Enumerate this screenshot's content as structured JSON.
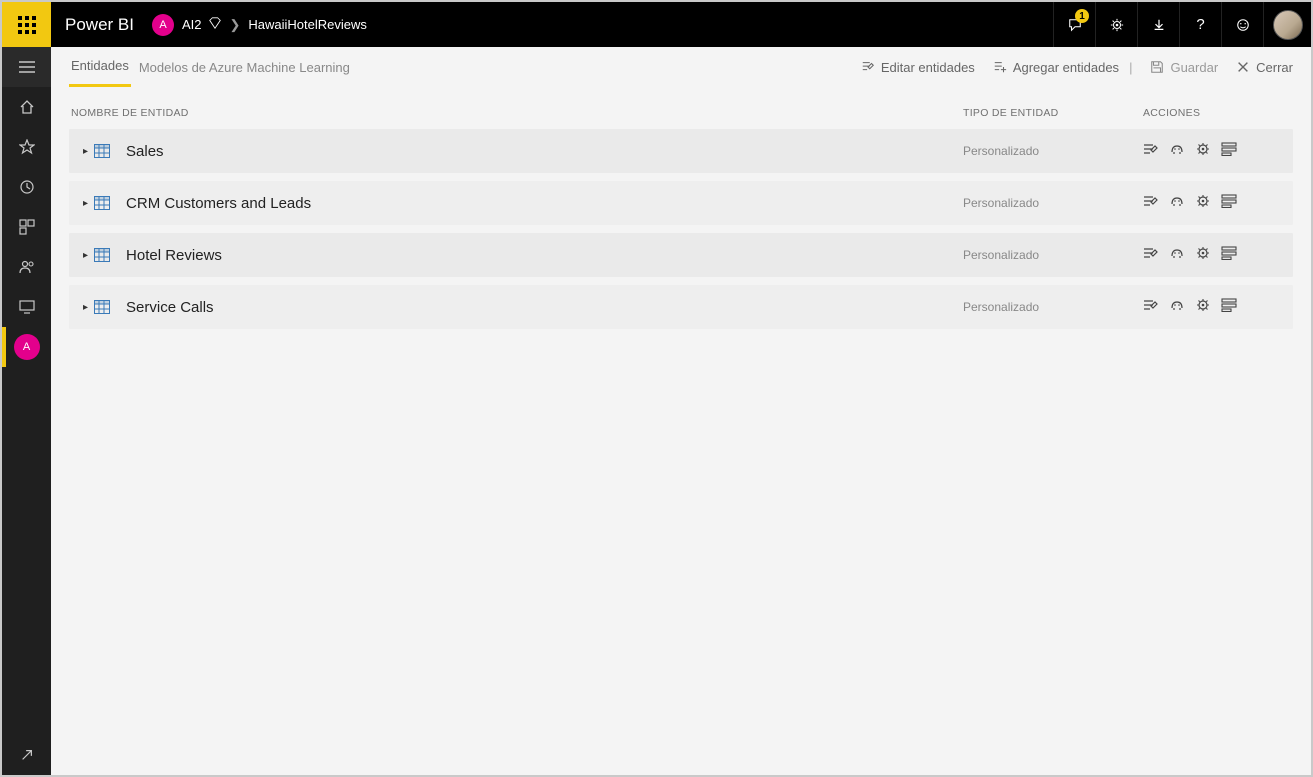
{
  "topbar": {
    "brand": "Power BI",
    "workspace_initial": "A",
    "workspace_name": "AI2",
    "breadcrumb": "HawaiiHotelReviews",
    "notification_count": "1"
  },
  "leftnav": {
    "workspace_initial": "A"
  },
  "actionbar": {
    "tab_entities": "Entidades",
    "tab_models": "Modelos de Azure Machine Learning",
    "edit_entities": "Editar entidades",
    "add_entities": "Agregar entidades",
    "save": "Guardar",
    "close": "Cerrar"
  },
  "grid": {
    "col_name": "NOMBRE DE ENTIDAD",
    "col_type": "TIPO DE ENTIDAD",
    "col_actions": "ACCIONES",
    "rows": [
      {
        "name": "Sales",
        "type": "Personalizado"
      },
      {
        "name": "CRM Customers and Leads",
        "type": "Personalizado"
      },
      {
        "name": "Hotel Reviews",
        "type": "Personalizado"
      },
      {
        "name": "Service Calls",
        "type": "Personalizado"
      }
    ]
  }
}
